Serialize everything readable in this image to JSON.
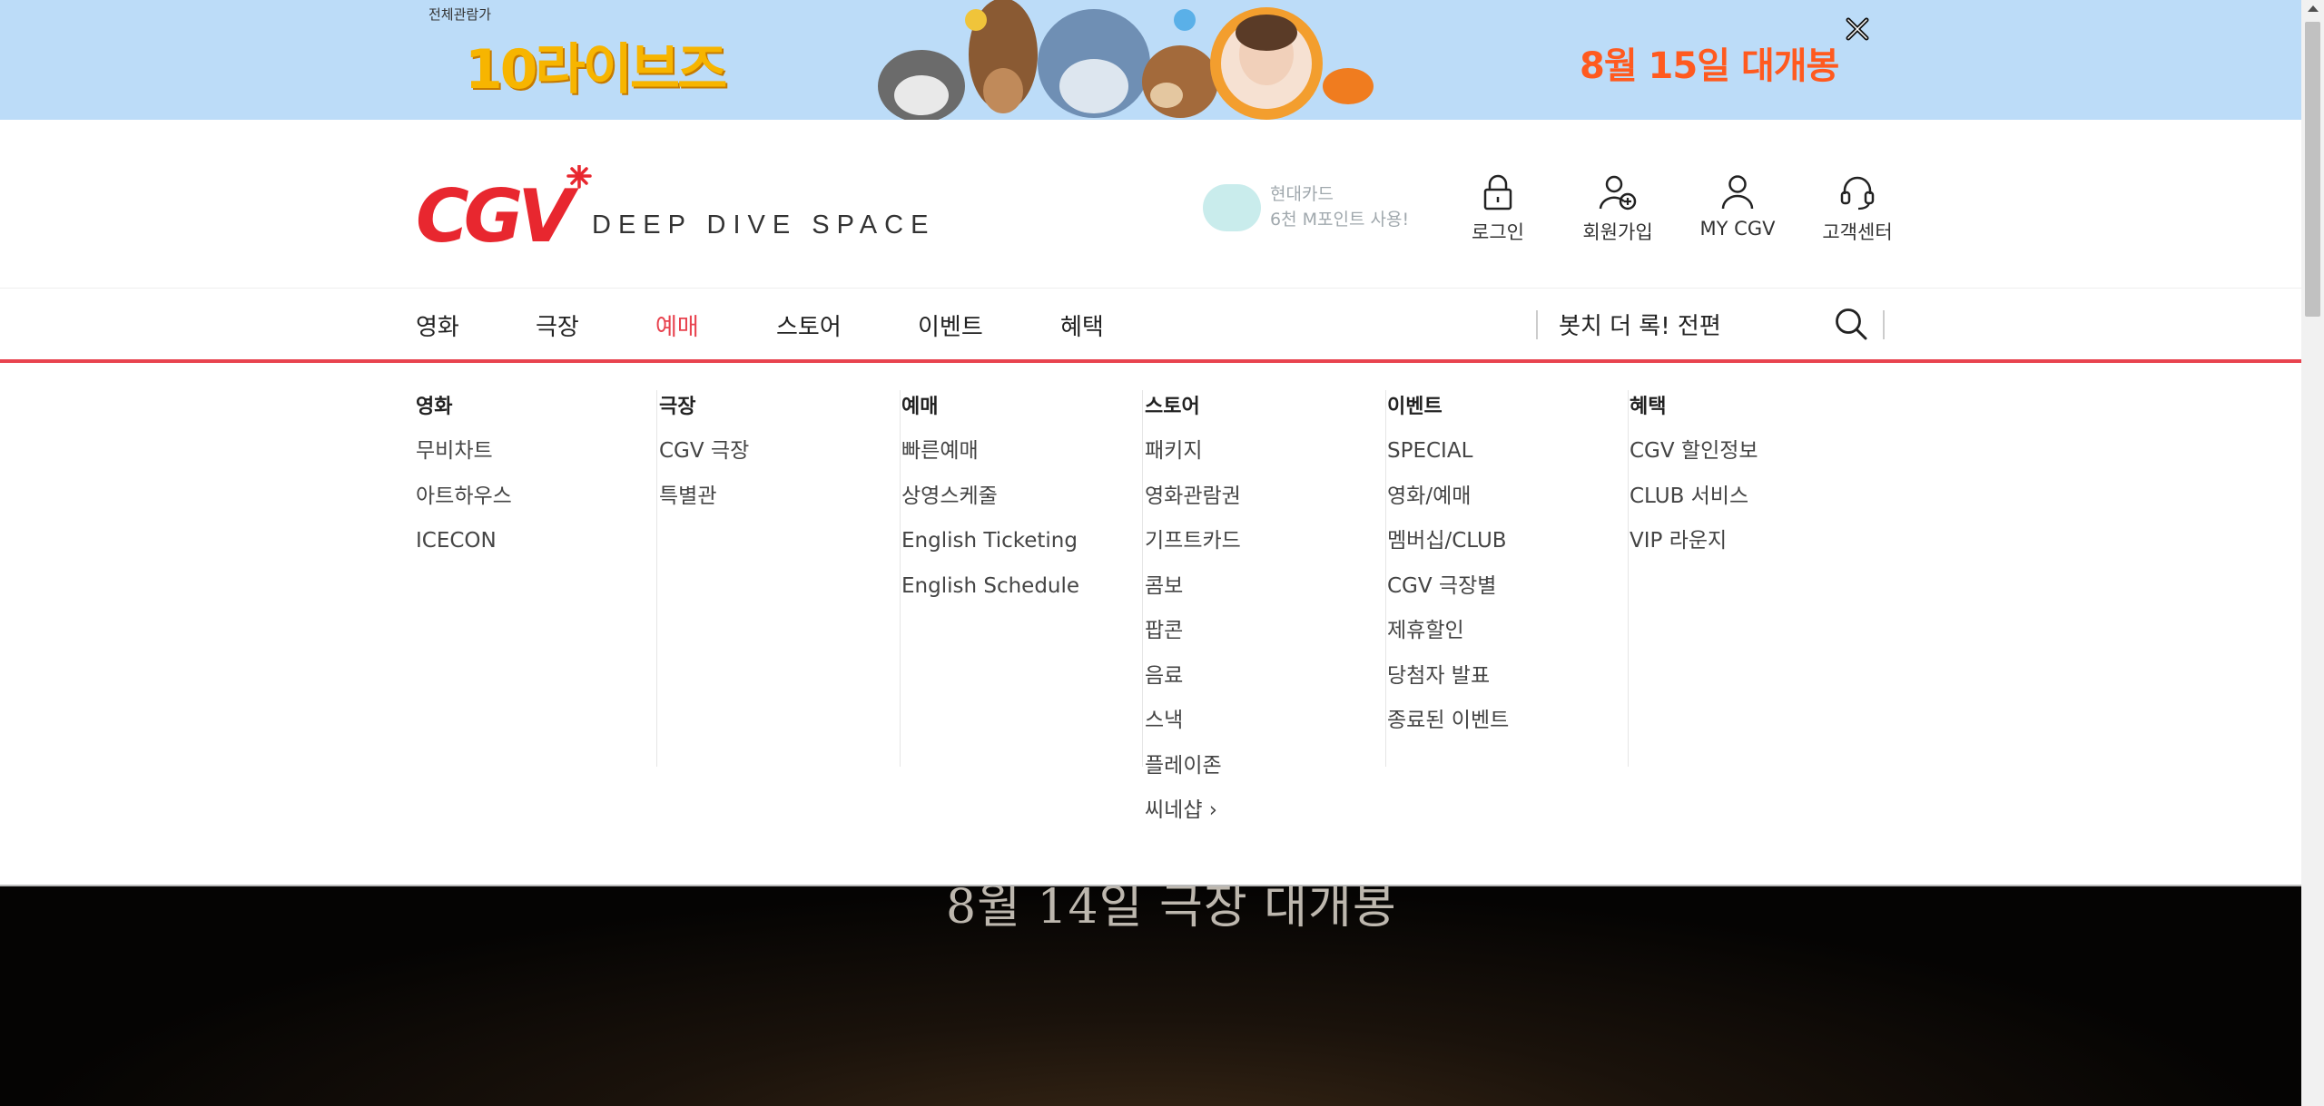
{
  "banner": {
    "rating": "전체관람가",
    "title": "10라이브즈",
    "release": "8월 15일 대개봉",
    "bg_color": "#bcdcf8",
    "close_icon": "close-icon"
  },
  "header": {
    "logo": "CGV",
    "tagline": "DEEP DIVE SPACE",
    "promo": {
      "line1": "현대카드",
      "line2": "6천 M포인트 사용!"
    },
    "utils": [
      {
        "label": "로그인",
        "icon": "lock-icon"
      },
      {
        "label": "회원가입",
        "icon": "add-user-icon"
      },
      {
        "label": "MY CGV",
        "icon": "user-icon"
      },
      {
        "label": "고객센터",
        "icon": "headset-icon"
      }
    ]
  },
  "gnb": {
    "items": [
      {
        "label": "영화"
      },
      {
        "label": "극장"
      },
      {
        "label": "예매",
        "active": true
      },
      {
        "label": "스토어"
      },
      {
        "label": "이벤트"
      },
      {
        "label": "혜택"
      }
    ],
    "search_value": "봇치 더 록! 전편",
    "accent_color": "#e8434f"
  },
  "menu": {
    "columns": [
      {
        "title": "영화",
        "items": [
          "무비차트",
          "아트하우스",
          "ICECON"
        ]
      },
      {
        "title": "극장",
        "items": [
          "CGV 극장",
          "특별관"
        ]
      },
      {
        "title": "예매",
        "items": [
          "빠른예매",
          "상영스케줄",
          "English Ticketing",
          "English Schedule"
        ]
      },
      {
        "title": "스토어",
        "items": [
          "패키지",
          "영화관람권",
          "기프트카드",
          "콤보",
          "팝콘",
          "음료",
          "스낵",
          "플레이존",
          "씨네샵 ›"
        ]
      },
      {
        "title": "이벤트",
        "items": [
          "SPECIAL",
          "영화/예매",
          "멤버십/CLUB",
          "CGV 극장별",
          "제휴할인",
          "당첨자 발표",
          "종료된 이벤트"
        ]
      },
      {
        "title": "혜택",
        "items": [
          "CGV 할인정보",
          "CLUB 서비스",
          "VIP 라운지"
        ]
      }
    ]
  },
  "hero": {
    "text": "8월 14일 극장 대개봉"
  }
}
